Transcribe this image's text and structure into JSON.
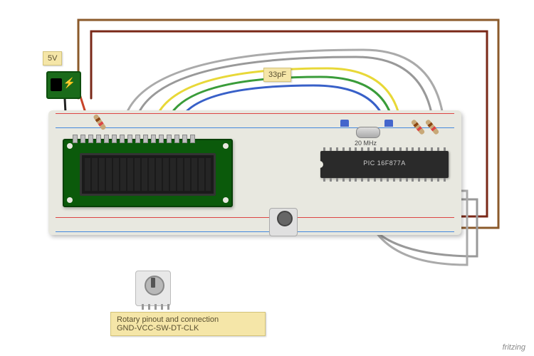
{
  "notes": {
    "voltage": "5V",
    "cap_value": "33pF",
    "crystal_freq": "20 MHz",
    "rotary_title": "Rotary pinout and connection",
    "rotary_pins": "GND-VCC-SW-DT-CLK"
  },
  "components": {
    "chip_label": "PIC 16F877A",
    "lcd_type": "16x2 LCD",
    "power": "5V DC Jack",
    "potentiometer": "Trimmer Pot",
    "rotary_encoder": "Rotary Encoder",
    "crystal": "20 MHz Crystal",
    "capacitors": "33pF Ceramic"
  },
  "wire_colors": {
    "power_pos": "#c8442a",
    "power_neg": "#222",
    "yellow": "#e8d838",
    "green": "#3a9c3a",
    "blue": "#3860c8",
    "grey": "#999",
    "brown": "#8b5a2b",
    "darkred": "#7a2818"
  },
  "footer_credit": "fritzing"
}
